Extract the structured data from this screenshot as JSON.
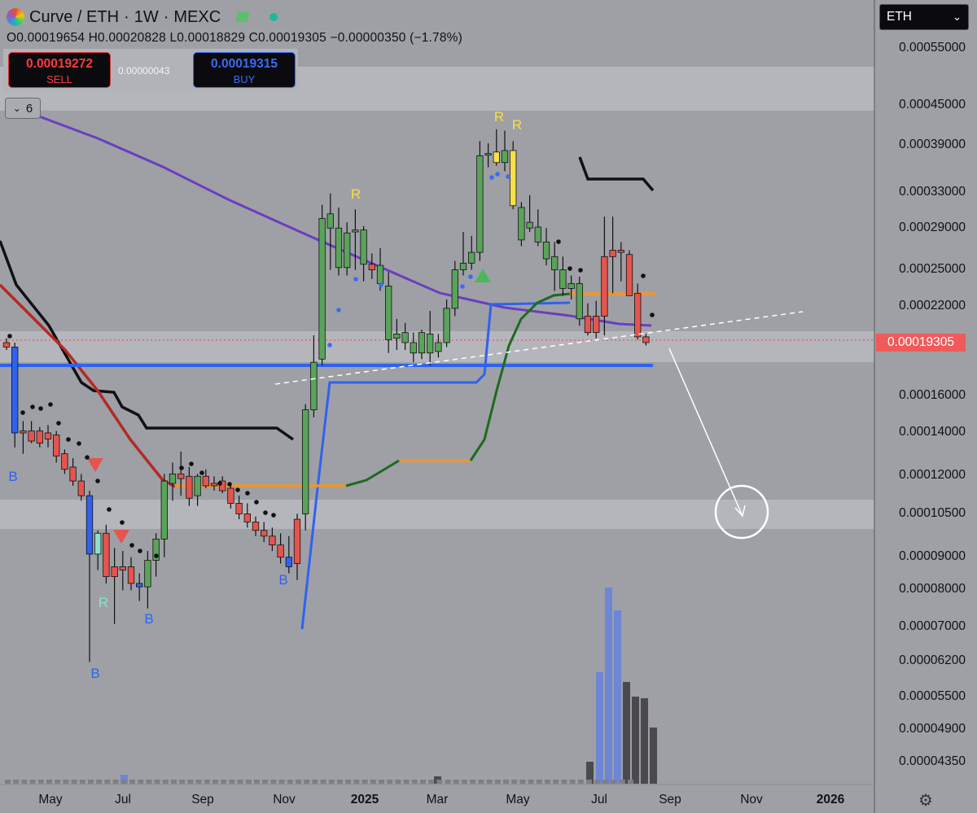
{
  "header": {
    "symbol": "Curve / ETH",
    "interval": "1W",
    "exchange": "MEXC",
    "separator": "·",
    "ohlc": "O0.00019654 H0.00020828 L0.00018829 C0.00019305 −0.00000350 (−1.78%)"
  },
  "trade": {
    "sell_price": "0.00019272",
    "sell_label": "SELL",
    "spread": "0.00000043",
    "buy_price": "0.00019315",
    "buy_label": "BUY"
  },
  "indicators_count": "6",
  "currency_select": "ETH",
  "last_price": "0.00019305",
  "colors": {
    "background": "#9ea0a6",
    "bull": "#5aa35a",
    "bear": "#e5544f",
    "signal_yellow": "#f5e04a",
    "blue": "#2f62f0",
    "purple": "#6a3fbf",
    "orange": "#f0962c",
    "dark_green": "#1e6a1e",
    "volume_blue": "#6f86d6",
    "volume_dark": "#4a4a4e"
  },
  "chart_data": {
    "type": "candlestick",
    "y_scale": "log",
    "ylim": [
      3.85e-05,
      0.00058
    ],
    "y_ticks": [
      "0.00055000",
      "0.00045000",
      "0.00039000",
      "0.00033000",
      "0.00029000",
      "0.00025000",
      "0.00022000",
      "0.00019305",
      "0.00016000",
      "0.00014000",
      "0.00012000",
      "0.00010500",
      "0.00009000",
      "0.00008000",
      "0.00007000",
      "0.00006200",
      "0.00005500",
      "0.00004900",
      "0.00004350"
    ],
    "x_ticks": [
      "May",
      "Jul",
      "Sep",
      "Nov",
      "2025",
      "Mar",
      "May",
      "Jul",
      "Sep",
      "Nov",
      "2026"
    ],
    "bold_x_ticks": [
      "2025",
      "2026"
    ],
    "annotations": [
      "B",
      "B",
      "B",
      "R",
      "B",
      "R",
      "R",
      "R"
    ],
    "candles": [
      {
        "o": 0.000193,
        "h": 0.000196,
        "l": 0.000188,
        "c": 0.00019,
        "t": "bear"
      },
      {
        "o": 0.00019,
        "h": 0.000193,
        "l": 0.000133,
        "c": 0.00014,
        "t": "blue"
      },
      {
        "o": 0.00014,
        "h": 0.000146,
        "l": 0.00013,
        "c": 0.000141,
        "t": "bear"
      },
      {
        "o": 0.000141,
        "h": 0.000146,
        "l": 0.000135,
        "c": 0.000136,
        "t": "bear"
      },
      {
        "o": 0.000141,
        "h": 0.000143,
        "l": 0.000133,
        "c": 0.000135,
        "t": "bear"
      },
      {
        "o": 0.00014,
        "h": 0.000144,
        "l": 0.000133,
        "c": 0.000137,
        "t": "bear"
      },
      {
        "o": 0.000139,
        "h": 0.000141,
        "l": 0.000126,
        "c": 0.000129,
        "t": "bear"
      },
      {
        "o": 0.00013,
        "h": 0.000132,
        "l": 0.000121,
        "c": 0.000123,
        "t": "bear"
      },
      {
        "o": 0.000124,
        "h": 0.000128,
        "l": 0.000116,
        "c": 0.000118,
        "t": "bear"
      },
      {
        "o": 0.000118,
        "h": 0.000121,
        "l": 0.00011,
        "c": 0.000112,
        "t": "bear"
      },
      {
        "o": 0.000112,
        "h": 0.000114,
        "l": 6.2e-05,
        "c": 9.1e-05,
        "t": "blue"
      },
      {
        "o": 9.1e-05,
        "h": 9.9e-05,
        "l": 8.6e-05,
        "c": 9.8e-05,
        "t": "teal"
      },
      {
        "o": 9.8e-05,
        "h": 0.000101,
        "l": 8.2e-05,
        "c": 8.4e-05,
        "t": "bear"
      },
      {
        "o": 8.7e-05,
        "h": 9.3e-05,
        "l": 7.1e-05,
        "c": 8.4e-05,
        "t": "bear"
      },
      {
        "o": 8.7e-05,
        "h": 9.2e-05,
        "l": 8e-05,
        "c": 8.6e-05,
        "t": "bear"
      },
      {
        "o": 8.7e-05,
        "h": 9e-05,
        "l": 8e-05,
        "c": 8.2e-05,
        "t": "bear"
      },
      {
        "o": 8.2e-05,
        "h": 8.5e-05,
        "l": 7.7e-05,
        "c": 8.1e-05,
        "t": "blue"
      },
      {
        "o": 8.1e-05,
        "h": 9.2e-05,
        "l": 7.5e-05,
        "c": 8.9e-05,
        "t": "bull"
      },
      {
        "o": 8.9e-05,
        "h": 9.8e-05,
        "l": 8.4e-05,
        "c": 9.6e-05,
        "t": "bull"
      },
      {
        "o": 9.6e-05,
        "h": 0.000121,
        "l": 9e-05,
        "c": 0.000118,
        "t": "bull"
      },
      {
        "o": 0.000117,
        "h": 0.000126,
        "l": 0.00011,
        "c": 0.000121,
        "t": "bull"
      },
      {
        "o": 0.000121,
        "h": 0.000131,
        "l": 0.000112,
        "c": 0.000119,
        "t": "bear"
      },
      {
        "o": 0.00012,
        "h": 0.000124,
        "l": 0.000108,
        "c": 0.000111,
        "t": "bear"
      },
      {
        "o": 0.000112,
        "h": 0.000121,
        "l": 0.000108,
        "c": 0.00012,
        "t": "bull"
      },
      {
        "o": 0.00012,
        "h": 0.000123,
        "l": 0.000115,
        "c": 0.000116,
        "t": "bear"
      },
      {
        "o": 0.000116,
        "h": 0.00012,
        "l": 0.000114,
        "c": 0.000117,
        "t": "bear"
      },
      {
        "o": 0.000118,
        "h": 0.00012,
        "l": 0.000113,
        "c": 0.000114,
        "t": "bear"
      },
      {
        "o": 0.000115,
        "h": 0.000117,
        "l": 0.000107,
        "c": 0.000109,
        "t": "bear"
      },
      {
        "o": 0.000109,
        "h": 0.000112,
        "l": 0.000103,
        "c": 0.000105,
        "t": "bear"
      },
      {
        "o": 0.000105,
        "h": 0.000109,
        "l": 0.0001,
        "c": 0.000102,
        "t": "bear"
      },
      {
        "o": 0.000102,
        "h": 0.000104,
        "l": 9.7e-05,
        "c": 9.9e-05,
        "t": "bear"
      },
      {
        "o": 9.9e-05,
        "h": 0.000102,
        "l": 9.5e-05,
        "c": 9.7e-05,
        "t": "bear"
      },
      {
        "o": 9.7e-05,
        "h": 0.0001,
        "l": 9.2e-05,
        "c": 9.4e-05,
        "t": "bear"
      },
      {
        "o": 9.4e-05,
        "h": 9.8e-05,
        "l": 8.8e-05,
        "c": 9e-05,
        "t": "bear"
      },
      {
        "o": 9e-05,
        "h": 9.7e-05,
        "l": 8.5e-05,
        "c": 8.7e-05,
        "t": "blue"
      },
      {
        "o": 8.8e-05,
        "h": 0.000105,
        "l": 8.3e-05,
        "c": 0.000103,
        "t": "bear"
      },
      {
        "o": 0.000105,
        "h": 0.000155,
        "l": 9.9e-05,
        "c": 0.000152,
        "t": "bull"
      },
      {
        "o": 0.000152,
        "h": 0.000198,
        "l": 0.000148,
        "c": 0.00018,
        "t": "bull"
      },
      {
        "o": 0.000182,
        "h": 0.000315,
        "l": 0.000178,
        "c": 0.0003,
        "t": "bull"
      },
      {
        "o": 0.000305,
        "h": 0.000328,
        "l": 0.00025,
        "c": 0.00029,
        "t": "bull"
      },
      {
        "o": 0.00029,
        "h": 0.000312,
        "l": 0.000245,
        "c": 0.000252,
        "t": "bull"
      },
      {
        "o": 0.000252,
        "h": 0.000296,
        "l": 0.000245,
        "c": 0.000285,
        "t": "bull"
      },
      {
        "o": 0.000286,
        "h": 0.00031,
        "l": 0.00025,
        "c": 0.000288,
        "t": "bull"
      },
      {
        "o": 0.000288,
        "h": 0.000292,
        "l": 0.00024,
        "c": 0.000255,
        "t": "bull"
      },
      {
        "o": 0.000255,
        "h": 0.000265,
        "l": 0.000242,
        "c": 0.00025,
        "t": "bear"
      },
      {
        "o": 0.000254,
        "h": 0.00027,
        "l": 0.000232,
        "c": 0.000238,
        "t": "bull"
      },
      {
        "o": 0.000236,
        "h": 0.000248,
        "l": 0.000186,
        "c": 0.000195,
        "t": "bull"
      },
      {
        "o": 0.000196,
        "h": 0.00021,
        "l": 0.000188,
        "c": 0.000199,
        "t": "bull"
      },
      {
        "o": 0.0002,
        "h": 0.000207,
        "l": 0.000188,
        "c": 0.000193,
        "t": "bull"
      },
      {
        "o": 0.000193,
        "h": 0.0002,
        "l": 0.00018,
        "c": 0.000186,
        "t": "bull"
      },
      {
        "o": 0.000186,
        "h": 0.000202,
        "l": 0.000182,
        "c": 0.0002,
        "t": "bull"
      },
      {
        "o": 0.000199,
        "h": 0.000216,
        "l": 0.000178,
        "c": 0.000186,
        "t": "bull"
      },
      {
        "o": 0.000187,
        "h": 0.000199,
        "l": 0.000183,
        "c": 0.000193,
        "t": "bull"
      },
      {
        "o": 0.000193,
        "h": 0.000225,
        "l": 0.00019,
        "c": 0.000218,
        "t": "bull"
      },
      {
        "o": 0.000218,
        "h": 0.000258,
        "l": 0.000212,
        "c": 0.00025,
        "t": "bull"
      },
      {
        "o": 0.00025,
        "h": 0.000286,
        "l": 0.000245,
        "c": 0.000256,
        "t": "bull"
      },
      {
        "o": 0.000256,
        "h": 0.000282,
        "l": 0.00025,
        "c": 0.000266,
        "t": "bull"
      },
      {
        "o": 0.000266,
        "h": 0.000395,
        "l": 0.000258,
        "c": 0.000375,
        "t": "bull"
      },
      {
        "o": 0.000378,
        "h": 0.000392,
        "l": 0.00036,
        "c": 0.000378,
        "t": "bull"
      },
      {
        "o": 0.00038,
        "h": 0.000412,
        "l": 0.000362,
        "c": 0.000366,
        "t": "yellow"
      },
      {
        "o": 0.000366,
        "h": 0.00041,
        "l": 0.000355,
        "c": 0.000382,
        "t": "bull"
      },
      {
        "o": 0.000382,
        "h": 0.000395,
        "l": 0.00031,
        "c": 0.000314,
        "t": "yellow"
      },
      {
        "o": 0.000312,
        "h": 0.000318,
        "l": 0.000272,
        "c": 0.000278,
        "t": "bull"
      },
      {
        "o": 0.000296,
        "h": 0.000326,
        "l": 0.000286,
        "c": 0.00029,
        "t": "bull"
      },
      {
        "o": 0.000291,
        "h": 0.00031,
        "l": 0.000272,
        "c": 0.000276,
        "t": "bull"
      },
      {
        "o": 0.000276,
        "h": 0.00029,
        "l": 0.000254,
        "c": 0.00026,
        "t": "bull"
      },
      {
        "o": 0.000262,
        "h": 0.000276,
        "l": 0.000232,
        "c": 0.00025,
        "t": "bull"
      },
      {
        "o": 0.00025,
        "h": 0.000262,
        "l": 0.000228,
        "c": 0.000234,
        "t": "bull"
      },
      {
        "o": 0.000234,
        "h": 0.000245,
        "l": 0.000225,
        "c": 0.000238,
        "t": "bull"
      },
      {
        "o": 0.000238,
        "h": 0.000244,
        "l": 0.000205,
        "c": 0.00021,
        "t": "bull"
      },
      {
        "o": 0.000212,
        "h": 0.000222,
        "l": 0.000198,
        "c": 0.0002,
        "t": "bear"
      },
      {
        "o": 0.0002,
        "h": 0.000224,
        "l": 0.000196,
        "c": 0.000212,
        "t": "bear"
      },
      {
        "o": 0.000212,
        "h": 0.000302,
        "l": 0.000198,
        "c": 0.000262,
        "t": "bear"
      },
      {
        "o": 0.000262,
        "h": 0.000302,
        "l": 0.00023,
        "c": 0.000268,
        "t": "bear"
      },
      {
        "o": 0.000268,
        "h": 0.000276,
        "l": 0.00024,
        "c": 0.000266,
        "t": "bear"
      },
      {
        "o": 0.000264,
        "h": 0.000268,
        "l": 0.000228,
        "c": 0.000228,
        "t": "bear"
      },
      {
        "o": 0.00023,
        "h": 0.000238,
        "l": 0.000195,
        "c": 0.000197,
        "t": "bear"
      },
      {
        "o": 0.000197,
        "h": 0.000199,
        "l": 0.000191,
        "c": 0.000193,
        "t": "bear"
      }
    ]
  }
}
